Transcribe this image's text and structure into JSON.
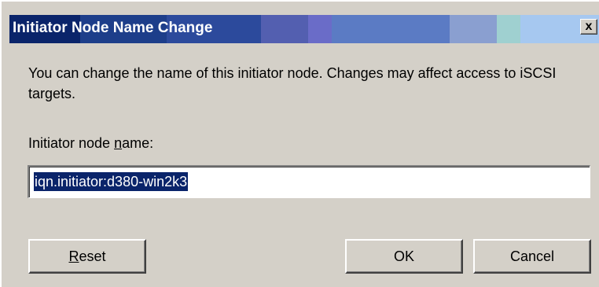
{
  "window": {
    "title": "Initiator Node Name Change",
    "close_glyph": "x"
  },
  "description": "You can change the name of this initiator node.  Changes may affect access to iSCSI targets.",
  "field": {
    "label_prefix": "Initiator node ",
    "label_mnemonic": "n",
    "label_suffix": "ame:",
    "value": "iqn.initiator:d380-win2k3"
  },
  "buttons": {
    "reset_mnemonic": "R",
    "reset_rest": "eset",
    "ok": "OK",
    "cancel": "Cancel"
  },
  "colors": {
    "titlebar_start": "#0a246a",
    "dialog_face": "#d4d0c8",
    "selection": "#0a246a"
  }
}
